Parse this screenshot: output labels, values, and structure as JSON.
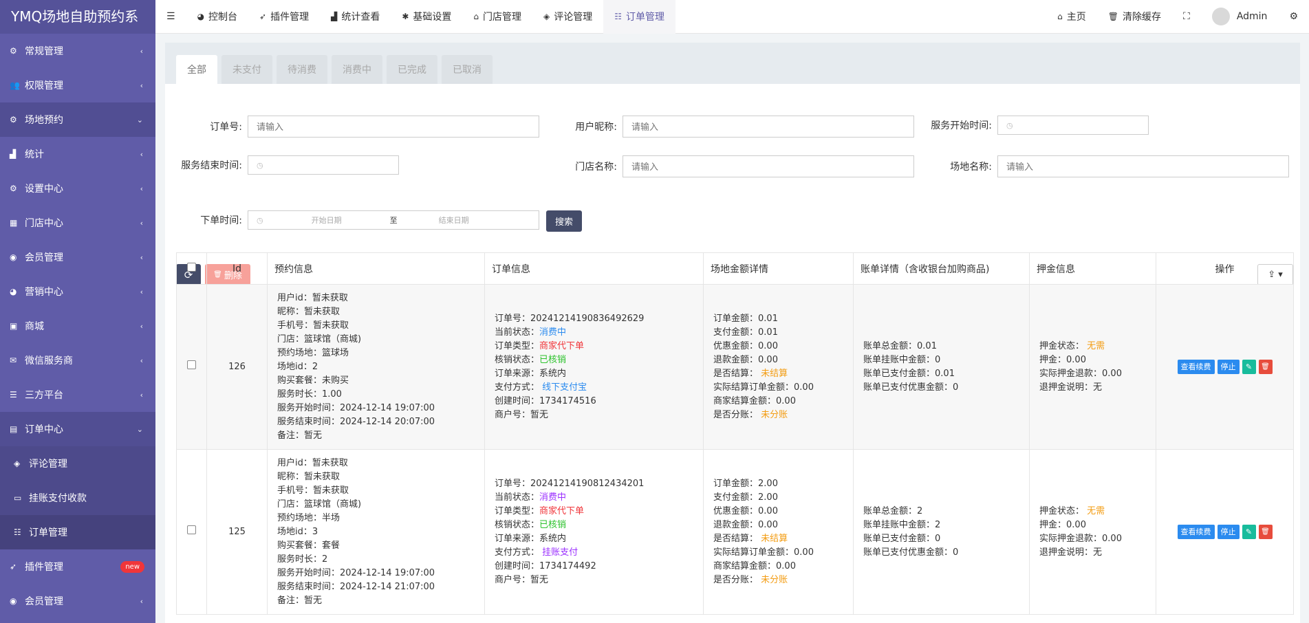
{
  "app": {
    "title": "YMQ场地自助预约系"
  },
  "sidebar": {
    "items": [
      {
        "label": "常规管理",
        "icon": "cogs-icon"
      },
      {
        "label": "权限管理",
        "icon": "group-icon"
      },
      {
        "label": "场地预约",
        "icon": "cogs-icon"
      },
      {
        "label": "统计",
        "icon": "area-chart-icon"
      },
      {
        "label": "设置中心",
        "icon": "cogs-icon"
      },
      {
        "label": "门店中心",
        "icon": "map-icon"
      },
      {
        "label": "会员管理",
        "icon": "user-circle-icon"
      },
      {
        "label": "营销中心",
        "icon": "dashboard-icon"
      },
      {
        "label": "商城",
        "icon": "briefcase-icon"
      },
      {
        "label": "微信服务商",
        "icon": "wechat-icon"
      },
      {
        "label": "三方平台",
        "icon": "sliders-icon"
      },
      {
        "label": "订单中心",
        "icon": "list-icon"
      },
      {
        "label": "评论管理",
        "icon": "tags-icon"
      },
      {
        "label": "挂账支付收款",
        "icon": "inbox-icon"
      },
      {
        "label": "订单管理",
        "icon": "list-icon"
      },
      {
        "label": "插件管理",
        "icon": "rocket-icon",
        "badge": "new"
      },
      {
        "label": "会员管理",
        "icon": "user-circle-icon"
      }
    ]
  },
  "topbar": {
    "tabs": [
      {
        "label": "控制台",
        "icon": "dashboard-icon"
      },
      {
        "label": "插件管理",
        "icon": "rocket-icon"
      },
      {
        "label": "统计查看",
        "icon": "area-chart-icon"
      },
      {
        "label": "基础设置",
        "icon": "asterisk-icon"
      },
      {
        "label": "门店管理",
        "icon": "home-icon"
      },
      {
        "label": "评论管理",
        "icon": "tags-icon"
      },
      {
        "label": "订单管理",
        "icon": "list-icon"
      }
    ],
    "home": "主页",
    "clear_cache": "清除缓存",
    "user": "Admin"
  },
  "status_tabs": [
    "全部",
    "未支付",
    "待消费",
    "消费中",
    "已完成",
    "已取消"
  ],
  "filters": {
    "order_no": {
      "label": "订单号:",
      "placeholder": "请输入"
    },
    "nickname": {
      "label": "用户昵称:",
      "placeholder": "请输入"
    },
    "service_start": {
      "label": "服务开始时间:"
    },
    "service_end": {
      "label": "服务结束时间:"
    },
    "store_name": {
      "label": "门店名称:",
      "placeholder": "请输入"
    },
    "venue_name": {
      "label": "场地名称:",
      "placeholder": "请输入"
    },
    "order_time": {
      "label": "下单时间:",
      "start": "开始日期",
      "sep": "至",
      "end": "结束日期"
    },
    "search": "搜索"
  },
  "toolbar": {
    "delete": "删除"
  },
  "table": {
    "headers": [
      "Id",
      "预约信息",
      "订单信息",
      "场地金额详情",
      "账单详情（含收银台加购商品)",
      "押金信息",
      "操作"
    ],
    "actions": {
      "view": "查看续费",
      "stop": "停止"
    },
    "rows": [
      {
        "id": "126",
        "booking": [
          "用户id：暂未获取",
          "昵称：暂未获取",
          "手机号：暂未获取",
          "门店：篮球馆（商城)",
          "预约场地：篮球场",
          "场地id：2",
          "购买套餐：未购买",
          "服务时长：1.00",
          "服务开始时间：2024-12-14 19:07:00",
          "服务结束时间：2024-12-14 20:07:00",
          "备注：暂无"
        ],
        "order": [
          {
            "k": "订单号：",
            "v": "20241214190836492629",
            "c": ""
          },
          {
            "k": "当前状态：",
            "v": "消费中",
            "c": "blue"
          },
          {
            "k": "订单类型：",
            "v": "商家代下单",
            "c": "red"
          },
          {
            "k": "核销状态：",
            "v": "已核销",
            "c": "green"
          },
          {
            "k": "订单来源：",
            "v": "系统内",
            "c": ""
          },
          {
            "k": "支付方式：",
            "v": " 线下支付宝",
            "c": "blue"
          },
          {
            "k": "创建时间：",
            "v": "1734174516",
            "c": ""
          },
          {
            "k": "商户号：",
            "v": "暂无",
            "c": ""
          }
        ],
        "amount": [
          {
            "k": "订单金额：",
            "v": "0.01",
            "c": ""
          },
          {
            "k": "支付金额：",
            "v": "0.01",
            "c": ""
          },
          {
            "k": "优惠金额：",
            "v": "0.00",
            "c": ""
          },
          {
            "k": "退款金额：",
            "v": "0.00",
            "c": ""
          },
          {
            "k": "是否结算：",
            "v": " 未结算",
            "c": "orange"
          },
          {
            "k": "实际结算订单金额：",
            "v": "0.00",
            "c": ""
          },
          {
            "k": "商家结算金额：",
            "v": "0.00",
            "c": ""
          },
          {
            "k": "是否分账：",
            "v": " 未分账",
            "c": "orange"
          }
        ],
        "bill": [
          {
            "k": "账单总金额：",
            "v": "0.01"
          },
          {
            "k": "账单挂账中金额：",
            "v": "0"
          },
          {
            "k": "账单已支付金额：",
            "v": "0.01"
          },
          {
            "k": "账单已支付优惠金额：",
            "v": "0"
          }
        ],
        "deposit": [
          {
            "k": "押金状态：",
            "v": " 无需",
            "c": "orange"
          },
          {
            "k": "押金：",
            "v": "0.00",
            "c": ""
          },
          {
            "k": "实际押金退款：",
            "v": "0.00",
            "c": ""
          },
          {
            "k": "退押金说明：",
            "v": "无",
            "c": ""
          }
        ]
      },
      {
        "id": "125",
        "booking": [
          "用户id：暂未获取",
          "昵称：暂未获取",
          "手机号：暂未获取",
          "门店：篮球馆（商城)",
          "预约场地：半场",
          "场地id：3",
          "购买套餐：套餐",
          "服务时长：2",
          "服务开始时间：2024-12-14 19:07:00",
          "服务结束时间：2024-12-14 21:07:00",
          "备注：暂无"
        ],
        "order": [
          {
            "k": "订单号：",
            "v": "20241214190812434201",
            "c": ""
          },
          {
            "k": "当前状态：",
            "v": "消费中",
            "c": "purple"
          },
          {
            "k": "订单类型：",
            "v": "商家代下单",
            "c": "red"
          },
          {
            "k": "核销状态：",
            "v": "已核销",
            "c": "green"
          },
          {
            "k": "订单来源：",
            "v": "系统内",
            "c": ""
          },
          {
            "k": "支付方式：",
            "v": " 挂账支付",
            "c": "purple"
          },
          {
            "k": "创建时间：",
            "v": "1734174492",
            "c": ""
          },
          {
            "k": "商户号：",
            "v": "暂无",
            "c": ""
          }
        ],
        "amount": [
          {
            "k": "订单金额：",
            "v": "2.00",
            "c": ""
          },
          {
            "k": "支付金额：",
            "v": "2.00",
            "c": ""
          },
          {
            "k": "优惠金额：",
            "v": "0.00",
            "c": ""
          },
          {
            "k": "退款金额：",
            "v": "0.00",
            "c": ""
          },
          {
            "k": "是否结算：",
            "v": " 未结算",
            "c": "orange"
          },
          {
            "k": "实际结算订单金额：",
            "v": "0.00",
            "c": ""
          },
          {
            "k": "商家结算金额：",
            "v": "0.00",
            "c": ""
          },
          {
            "k": "是否分账：",
            "v": " 未分账",
            "c": "orange"
          }
        ],
        "bill": [
          {
            "k": "账单总金额：",
            "v": "2"
          },
          {
            "k": "账单挂账中金额：",
            "v": "2"
          },
          {
            "k": "账单已支付金额：",
            "v": "0"
          },
          {
            "k": "账单已支付优惠金额：",
            "v": "0"
          }
        ],
        "deposit": [
          {
            "k": "押金状态：",
            "v": " 无需",
            "c": "orange"
          },
          {
            "k": "押金：",
            "v": "0.00",
            "c": ""
          },
          {
            "k": "实际押金退款：",
            "v": "0.00",
            "c": ""
          },
          {
            "k": "退押金说明：",
            "v": "无",
            "c": ""
          }
        ]
      }
    ]
  }
}
